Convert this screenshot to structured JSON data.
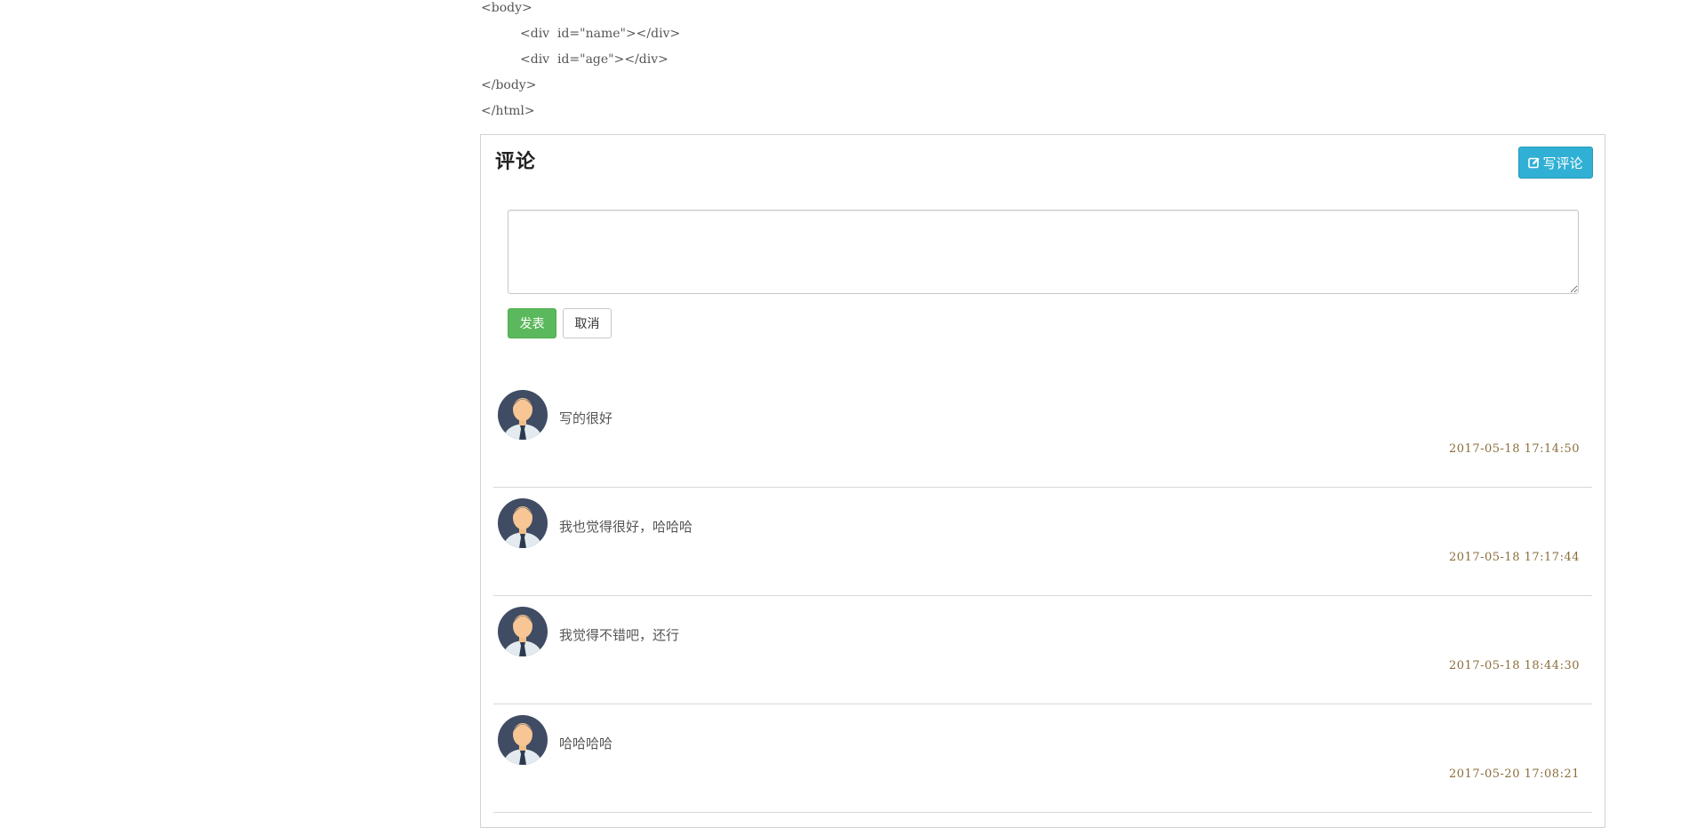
{
  "code_lines": [
    "<body>",
    "<div  id=\"name\"></div>",
    "<div  id=\"age\"></div>",
    "</body>",
    "</html>"
  ],
  "comments_section": {
    "title": "评论",
    "write_button_label": "写评论",
    "input_placeholder": "",
    "input_value": "",
    "submit_label": "发表",
    "cancel_label": "取消",
    "colors": {
      "write_button": "#31b0d5",
      "submit_button": "#5cb85c",
      "timestamp": "#8a6d3b"
    }
  },
  "comments": [
    {
      "text": "写的很好",
      "time": "2017-05-18 17:14:50",
      "avatar_icon": "user-avatar-icon"
    },
    {
      "text": "我也觉得很好，哈哈哈",
      "time": "2017-05-18 17:17:44",
      "avatar_icon": "user-avatar-icon"
    },
    {
      "text": "我觉得不错吧，还行",
      "time": "2017-05-18 18:44:30",
      "avatar_icon": "user-avatar-icon"
    },
    {
      "text": "哈哈哈哈",
      "time": "2017-05-20 17:08:21",
      "avatar_icon": "user-avatar-icon"
    }
  ]
}
